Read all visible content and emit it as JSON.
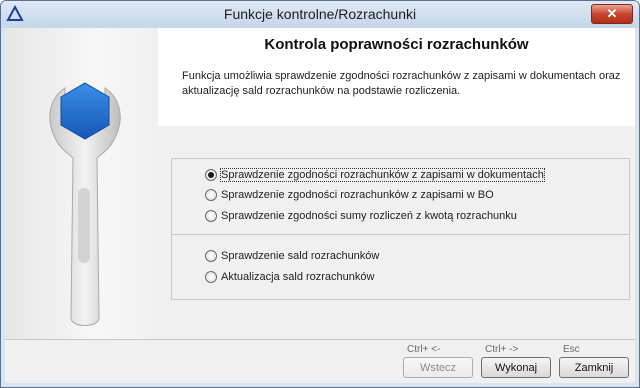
{
  "window": {
    "title": "Funkcje kontrolne/Rozrachunki",
    "close_label": "✕"
  },
  "header": {
    "heading": "Kontrola poprawności rozrachunków",
    "description": "Funkcja umożliwia sprawdzenie zgodności rozrachunków z zapisami w dokumentach oraz aktualizację sald rozrachunków na podstawie rozliczenia."
  },
  "options": [
    {
      "label": "Sprawdzenie zgodności rozrachunków z zapisami w dokumentach",
      "selected": true
    },
    {
      "label": "Sprawdzenie zgodności rozrachunków z zapisami w BO",
      "selected": false
    },
    {
      "label": "Sprawdzenie zgodności sumy rozliczeń z kwotą rozrachunku",
      "selected": false
    },
    {
      "label": "Sprawdzenie sald rozrachunków",
      "selected": false
    },
    {
      "label": "Aktualizacja sald rozrachunków",
      "selected": false
    }
  ],
  "footer": {
    "back": {
      "label": "Wstecz",
      "shortcut": "Ctrl+ <-",
      "enabled": false
    },
    "run": {
      "label": "Wykonaj",
      "shortcut": "Ctrl+ ->",
      "enabled": true
    },
    "close": {
      "label": "Zamknij",
      "shortcut": "Esc",
      "enabled": true
    }
  },
  "colors": {
    "hexagon": "#1f73d1",
    "title_bar": "#c4d6ea",
    "close_button": "#c7452c"
  },
  "icons": {
    "app": "app-triangle-icon",
    "illustration": "wrench-hexagon-icon"
  }
}
